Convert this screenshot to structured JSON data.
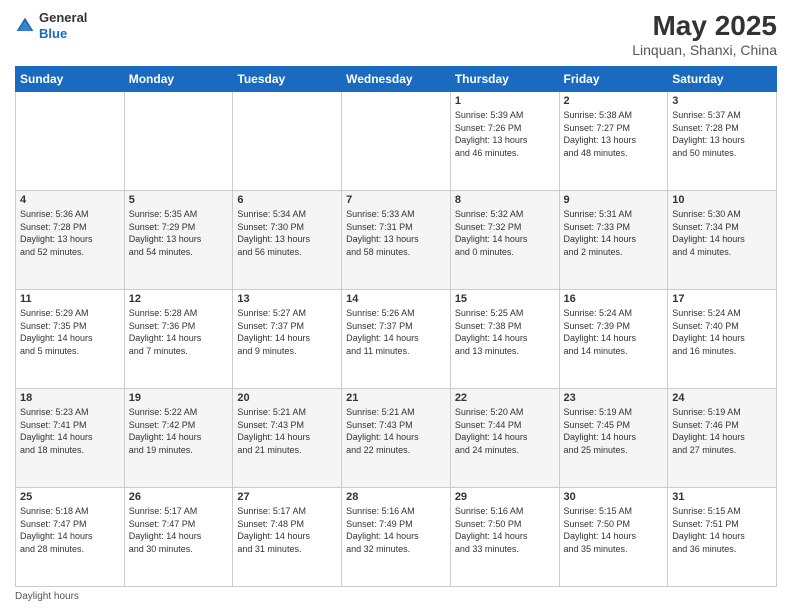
{
  "header": {
    "logo_line1": "General",
    "logo_line2": "Blue",
    "main_title": "May 2025",
    "subtitle": "Linquan, Shanxi, China"
  },
  "calendar": {
    "days_of_week": [
      "Sunday",
      "Monday",
      "Tuesday",
      "Wednesday",
      "Thursday",
      "Friday",
      "Saturday"
    ],
    "weeks": [
      [
        {
          "day": "",
          "info": ""
        },
        {
          "day": "",
          "info": ""
        },
        {
          "day": "",
          "info": ""
        },
        {
          "day": "",
          "info": ""
        },
        {
          "day": "1",
          "info": "Sunrise: 5:39 AM\nSunset: 7:26 PM\nDaylight: 13 hours\nand 46 minutes."
        },
        {
          "day": "2",
          "info": "Sunrise: 5:38 AM\nSunset: 7:27 PM\nDaylight: 13 hours\nand 48 minutes."
        },
        {
          "day": "3",
          "info": "Sunrise: 5:37 AM\nSunset: 7:28 PM\nDaylight: 13 hours\nand 50 minutes."
        }
      ],
      [
        {
          "day": "4",
          "info": "Sunrise: 5:36 AM\nSunset: 7:28 PM\nDaylight: 13 hours\nand 52 minutes."
        },
        {
          "day": "5",
          "info": "Sunrise: 5:35 AM\nSunset: 7:29 PM\nDaylight: 13 hours\nand 54 minutes."
        },
        {
          "day": "6",
          "info": "Sunrise: 5:34 AM\nSunset: 7:30 PM\nDaylight: 13 hours\nand 56 minutes."
        },
        {
          "day": "7",
          "info": "Sunrise: 5:33 AM\nSunset: 7:31 PM\nDaylight: 13 hours\nand 58 minutes."
        },
        {
          "day": "8",
          "info": "Sunrise: 5:32 AM\nSunset: 7:32 PM\nDaylight: 14 hours\nand 0 minutes."
        },
        {
          "day": "9",
          "info": "Sunrise: 5:31 AM\nSunset: 7:33 PM\nDaylight: 14 hours\nand 2 minutes."
        },
        {
          "day": "10",
          "info": "Sunrise: 5:30 AM\nSunset: 7:34 PM\nDaylight: 14 hours\nand 4 minutes."
        }
      ],
      [
        {
          "day": "11",
          "info": "Sunrise: 5:29 AM\nSunset: 7:35 PM\nDaylight: 14 hours\nand 5 minutes."
        },
        {
          "day": "12",
          "info": "Sunrise: 5:28 AM\nSunset: 7:36 PM\nDaylight: 14 hours\nand 7 minutes."
        },
        {
          "day": "13",
          "info": "Sunrise: 5:27 AM\nSunset: 7:37 PM\nDaylight: 14 hours\nand 9 minutes."
        },
        {
          "day": "14",
          "info": "Sunrise: 5:26 AM\nSunset: 7:37 PM\nDaylight: 14 hours\nand 11 minutes."
        },
        {
          "day": "15",
          "info": "Sunrise: 5:25 AM\nSunset: 7:38 PM\nDaylight: 14 hours\nand 13 minutes."
        },
        {
          "day": "16",
          "info": "Sunrise: 5:24 AM\nSunset: 7:39 PM\nDaylight: 14 hours\nand 14 minutes."
        },
        {
          "day": "17",
          "info": "Sunrise: 5:24 AM\nSunset: 7:40 PM\nDaylight: 14 hours\nand 16 minutes."
        }
      ],
      [
        {
          "day": "18",
          "info": "Sunrise: 5:23 AM\nSunset: 7:41 PM\nDaylight: 14 hours\nand 18 minutes."
        },
        {
          "day": "19",
          "info": "Sunrise: 5:22 AM\nSunset: 7:42 PM\nDaylight: 14 hours\nand 19 minutes."
        },
        {
          "day": "20",
          "info": "Sunrise: 5:21 AM\nSunset: 7:43 PM\nDaylight: 14 hours\nand 21 minutes."
        },
        {
          "day": "21",
          "info": "Sunrise: 5:21 AM\nSunset: 7:43 PM\nDaylight: 14 hours\nand 22 minutes."
        },
        {
          "day": "22",
          "info": "Sunrise: 5:20 AM\nSunset: 7:44 PM\nDaylight: 14 hours\nand 24 minutes."
        },
        {
          "day": "23",
          "info": "Sunrise: 5:19 AM\nSunset: 7:45 PM\nDaylight: 14 hours\nand 25 minutes."
        },
        {
          "day": "24",
          "info": "Sunrise: 5:19 AM\nSunset: 7:46 PM\nDaylight: 14 hours\nand 27 minutes."
        }
      ],
      [
        {
          "day": "25",
          "info": "Sunrise: 5:18 AM\nSunset: 7:47 PM\nDaylight: 14 hours\nand 28 minutes."
        },
        {
          "day": "26",
          "info": "Sunrise: 5:17 AM\nSunset: 7:47 PM\nDaylight: 14 hours\nand 30 minutes."
        },
        {
          "day": "27",
          "info": "Sunrise: 5:17 AM\nSunset: 7:48 PM\nDaylight: 14 hours\nand 31 minutes."
        },
        {
          "day": "28",
          "info": "Sunrise: 5:16 AM\nSunset: 7:49 PM\nDaylight: 14 hours\nand 32 minutes."
        },
        {
          "day": "29",
          "info": "Sunrise: 5:16 AM\nSunset: 7:50 PM\nDaylight: 14 hours\nand 33 minutes."
        },
        {
          "day": "30",
          "info": "Sunrise: 5:15 AM\nSunset: 7:50 PM\nDaylight: 14 hours\nand 35 minutes."
        },
        {
          "day": "31",
          "info": "Sunrise: 5:15 AM\nSunset: 7:51 PM\nDaylight: 14 hours\nand 36 minutes."
        }
      ]
    ]
  },
  "footer": {
    "daylight_label": "Daylight hours"
  }
}
